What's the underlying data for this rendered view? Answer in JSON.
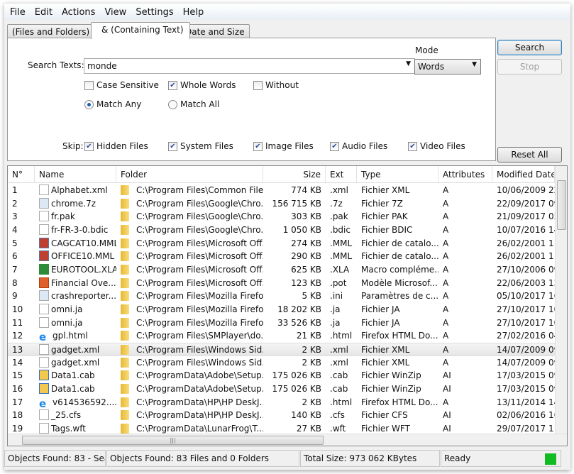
{
  "menu": [
    "File",
    "Edit",
    "Actions",
    "View",
    "Settings",
    "Help"
  ],
  "tabs": [
    "(Files and Folders)",
    "& (Containing Text)",
    "Date and Size"
  ],
  "search": {
    "label": "Search Texts:",
    "value": "monde",
    "mode_label": "Mode",
    "mode_value": "Words"
  },
  "options": {
    "case_sensitive": {
      "label": "Case Sensitive",
      "checked": false
    },
    "whole_words": {
      "label": "Whole Words",
      "checked": true
    },
    "without": {
      "label": "Without",
      "checked": false
    },
    "match_any": {
      "label": "Match Any",
      "selected": true
    },
    "match_all": {
      "label": "Match All",
      "selected": false
    }
  },
  "skip": {
    "label": "Skip:",
    "items": [
      {
        "label": "Hidden Files",
        "checked": true
      },
      {
        "label": "System Files",
        "checked": true
      },
      {
        "label": "Image Files",
        "checked": true
      },
      {
        "label": "Audio Files",
        "checked": true
      },
      {
        "label": "Video Files",
        "checked": true
      }
    ]
  },
  "buttons": {
    "search": "Search",
    "stop": "Stop",
    "reset": "Reset All"
  },
  "columns": [
    "N°",
    "Name",
    "Folder",
    "Size",
    "Ext",
    "Type",
    "Attributes",
    "Modified Date"
  ],
  "rows": [
    [
      "1",
      "Alphabet.xml",
      "C:\\Program Files\\Common File...",
      "774 KB",
      ".xml",
      "Fichier XML",
      "A",
      "10/06/2009 22",
      "doc"
    ],
    [
      "2",
      "chrome.7z",
      "C:\\Program Files\\Google\\Chro...",
      "156 715 KB",
      ".7z",
      "Fichier 7Z",
      "A",
      "22/09/2017 09",
      "cfg"
    ],
    [
      "3",
      "fr.pak",
      "C:\\Program Files\\Google\\Chro...",
      "303 KB",
      ".pak",
      "Fichier PAK",
      "A",
      "21/09/2017 05",
      "doc"
    ],
    [
      "4",
      "fr-FR-3-0.bdic",
      "C:\\Program Files\\Google\\Chro...",
      "1 050 KB",
      ".bdic",
      "Fichier BDIC",
      "A",
      "10/07/2016 14",
      "doc"
    ],
    [
      "5",
      "CAGCAT10.MML",
      "C:\\Program Files\\Microsoft Off...",
      "274 KB",
      ".MML",
      "Fichier de catalo...",
      "A",
      "26/02/2001 11",
      "img"
    ],
    [
      "6",
      "OFFICE10.MML",
      "C:\\Program Files\\Microsoft Off...",
      "290 KB",
      ".MML",
      "Fichier de catalo...",
      "A",
      "26/02/2001 11",
      "img"
    ],
    [
      "7",
      "EUROTOOL.XLA",
      "C:\\Program Files\\Microsoft Off...",
      "625 KB",
      ".XLA",
      "Macro compléme...",
      "A",
      "27/10/2006 09",
      "xls"
    ],
    [
      "8",
      "Financial Ove...",
      "C:\\Program Files\\Microsoft Off...",
      "123 KB",
      ".pot",
      "Modèle Microsof...",
      "A",
      "22/06/2003 13",
      "ppt"
    ],
    [
      "9",
      "crashreporter...",
      "C:\\Program Files\\Mozilla Firefox\\",
      "5 KB",
      ".ini",
      "Paramètres de c...",
      "A",
      "05/10/2017 16",
      "cfg"
    ],
    [
      "10",
      "omni.ja",
      "C:\\Program Files\\Mozilla Firefox\\",
      "18 202 KB",
      ".ja",
      "Fichier JA",
      "A",
      "27/10/2017 10",
      "doc"
    ],
    [
      "11",
      "omni.ja",
      "C:\\Program Files\\Mozilla Firefo...",
      "33 526 KB",
      ".ja",
      "Fichier JA",
      "A",
      "27/10/2017 10",
      "doc"
    ],
    [
      "12",
      "gpl.html",
      "C:\\Program Files\\SMPlayer\\do...",
      "21 KB",
      ".html",
      "Firefox HTML Do...",
      "A",
      "27/02/2016 04",
      "ie"
    ],
    [
      "13",
      "gadget.xml",
      "C:\\Program Files\\Windows Sid...",
      "2 KB",
      ".xml",
      "Fichier XML",
      "A",
      "14/07/2009 09",
      "doc"
    ],
    [
      "14",
      "gadget.xml",
      "C:\\Program Files\\Windows Sid...",
      "2 KB",
      ".xml",
      "Fichier XML",
      "A",
      "14/07/2009 09",
      "doc"
    ],
    [
      "15",
      "Data1.cab",
      "C:\\ProgramData\\Adobe\\Setup...",
      "175 026 KB",
      ".cab",
      "Fichier WinZip",
      "AI",
      "17/03/2015 09",
      "cab"
    ],
    [
      "16",
      "Data1.cab",
      "C:\\ProgramData\\Adobe\\Setup...",
      "175 026 KB",
      ".cab",
      "Fichier WinZip",
      "AI",
      "17/03/2015 09",
      "cab"
    ],
    [
      "17",
      "v614536592....",
      "C:\\ProgramData\\HP\\HP DeskJ...",
      "2 KB",
      ".html",
      "Firefox HTML Do...",
      "A",
      "13/11/2014 14",
      "ie"
    ],
    [
      "18",
      "_25.cfs",
      "C:\\ProgramData\\HP\\HP DeskJ...",
      "140 KB",
      ".cfs",
      "Fichier CFS",
      "AI",
      "02/06/2016 16",
      "doc"
    ],
    [
      "19",
      "Tags.wft",
      "C:\\ProgramData\\LunarFrog\\T...",
      "27 KB",
      ".wft",
      "Fichier WFT",
      "AI",
      "29/07/2017 11",
      "doc"
    ]
  ],
  "selected_row": 13,
  "status": {
    "left": "Objects Found: 83 - Searc",
    "found": "Objects Found: 83 Files and 0 Folders",
    "total": "Total Size: 973 062 KBytes",
    "state": "Ready",
    "led_color": "#11bb22"
  }
}
